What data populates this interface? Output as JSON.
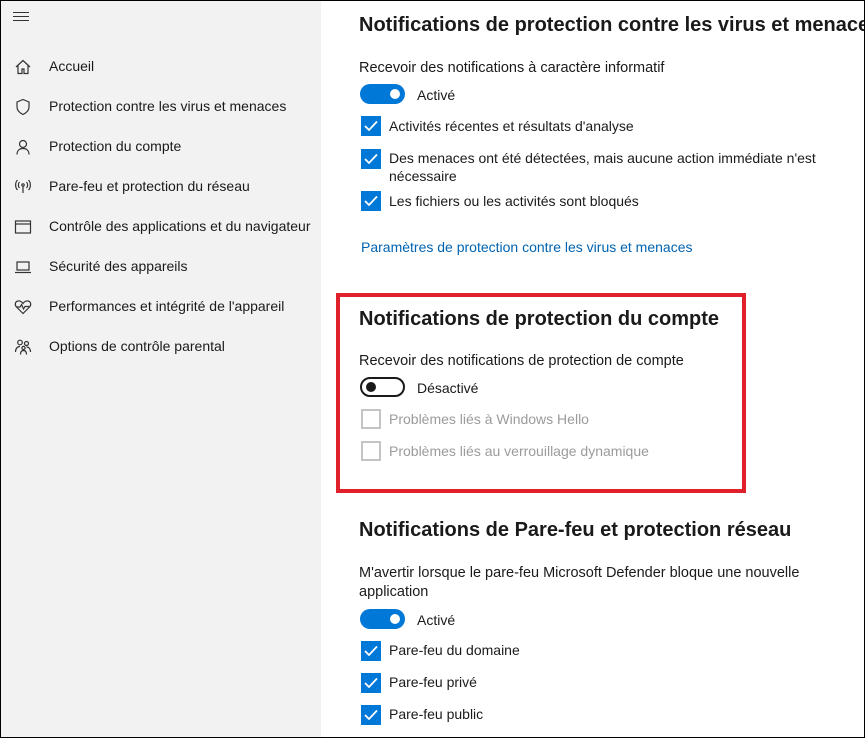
{
  "sidebar": {
    "items": [
      {
        "label": "Accueil",
        "icon": "home-icon"
      },
      {
        "label": "Protection contre les virus et menaces",
        "icon": "shield-icon"
      },
      {
        "label": "Protection du compte",
        "icon": "person-icon"
      },
      {
        "label": "Pare-feu et protection du réseau",
        "icon": "wifi-antenna-icon"
      },
      {
        "label": "Contrôle des applications et du navigateur",
        "icon": "browser-window-icon"
      },
      {
        "label": "Sécurité des appareils",
        "icon": "laptop-icon"
      },
      {
        "label": "Performances et intégrité de l'appareil",
        "icon": "heart-pulse-icon"
      },
      {
        "label": "Options de contrôle parental",
        "icon": "family-icon"
      }
    ]
  },
  "virus": {
    "title": "Notifications de protection contre les virus et menaces",
    "subtitle": "Recevoir des notifications à caractère informatif",
    "toggle_state": "on",
    "toggle_label": "Activé",
    "checkboxes": [
      {
        "label": "Activités récentes et résultats d'analyse",
        "checked": true
      },
      {
        "label_line1": "Des menaces ont été détectées, mais aucune action immédiate n'est",
        "label_line2": "nécessaire",
        "checked": true
      },
      {
        "label": "Les fichiers ou les activités sont bloqués",
        "checked": true
      }
    ],
    "link": "Paramètres de protection contre les virus et menaces"
  },
  "account": {
    "title": "Notifications de protection du compte",
    "subtitle": "Recevoir des notifications de protection de compte",
    "toggle_state": "off",
    "toggle_label": "Désactivé",
    "checkboxes": [
      {
        "label": "Problèmes liés à Windows Hello",
        "checked": false,
        "disabled": true
      },
      {
        "label": "Problèmes liés au verrouillage dynamique",
        "checked": false,
        "disabled": true
      }
    ]
  },
  "firewall": {
    "title": "Notifications de Pare-feu et protection réseau",
    "subtitle_line1": "M'avertir lorsque le pare-feu Microsoft Defender bloque une nouvelle",
    "subtitle_line2": "application",
    "toggle_state": "on",
    "toggle_label": "Activé",
    "checkboxes": [
      {
        "label": "Pare-feu du domaine",
        "checked": true
      },
      {
        "label": "Pare-feu privé",
        "checked": true
      },
      {
        "label": "Pare-feu public",
        "checked": true
      }
    ]
  },
  "colors": {
    "accent": "#0078d7",
    "highlight": "#e0202a",
    "sidebar_bg": "#f2f2f2",
    "link": "#0063b1"
  }
}
